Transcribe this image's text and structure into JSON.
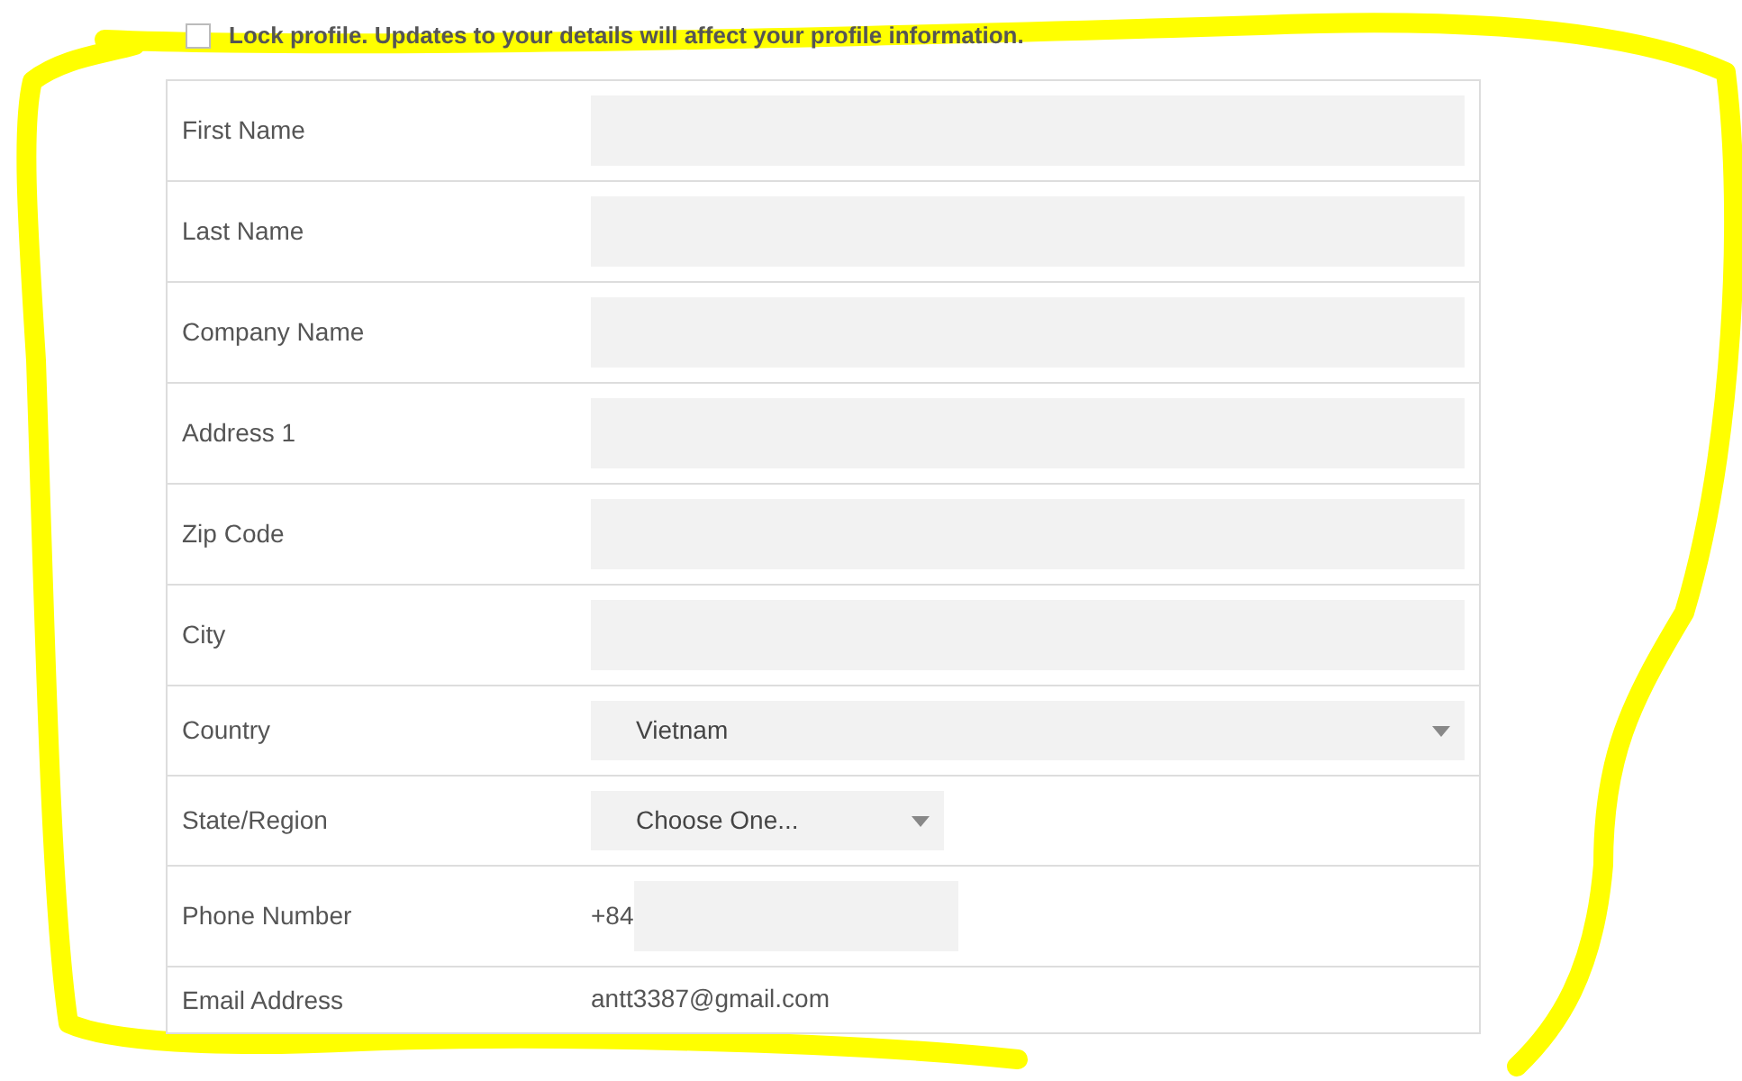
{
  "lock_profile": {
    "label": "Lock profile. Updates to your details will affect your profile information.",
    "checked": false
  },
  "fields": [
    {
      "kind": "text",
      "label": "First Name"
    },
    {
      "kind": "text",
      "label": "Last Name"
    },
    {
      "kind": "text",
      "label": "Company Name"
    },
    {
      "kind": "text",
      "label": "Address 1"
    },
    {
      "kind": "text",
      "label": "Zip Code"
    },
    {
      "kind": "text",
      "label": "City"
    },
    {
      "kind": "select",
      "label": "Country",
      "value": "Vietnam",
      "wide": true
    },
    {
      "kind": "select",
      "label": "State/Region",
      "value": "Choose One...",
      "wide": false
    },
    {
      "kind": "phone",
      "label": "Phone Number",
      "prefix": "+84"
    },
    {
      "kind": "static",
      "label": "Email Address",
      "value": "antt3387@gmail.com"
    }
  ]
}
